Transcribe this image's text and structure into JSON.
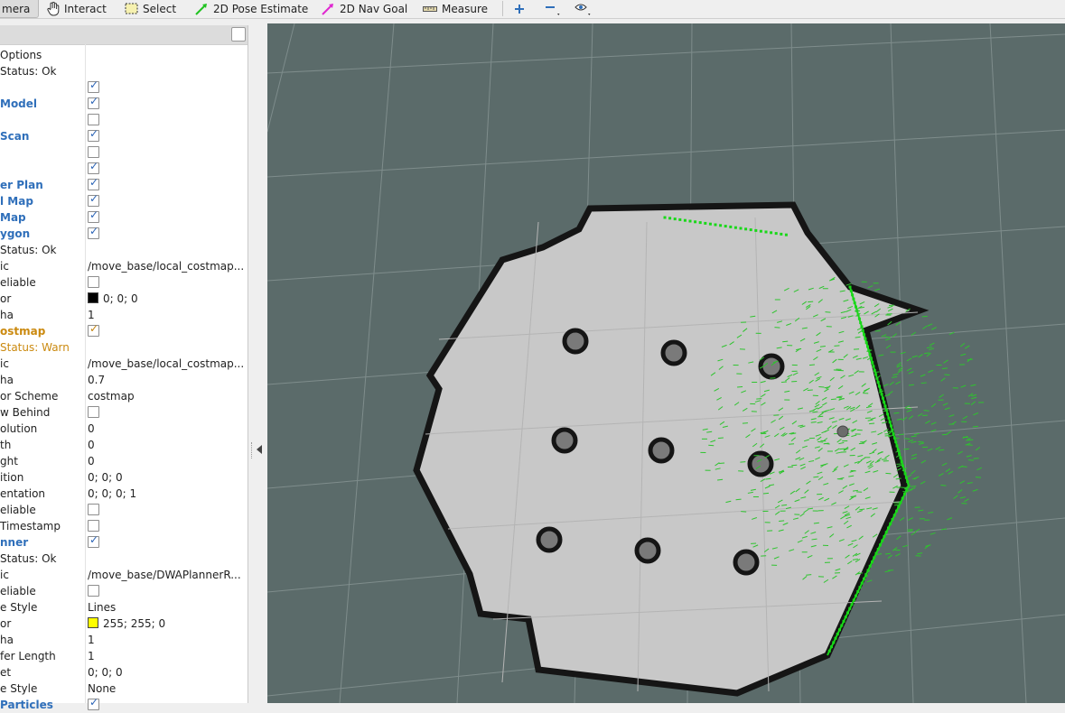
{
  "toolbar": {
    "items": [
      {
        "label": "mera",
        "icon": "camera-icon"
      },
      {
        "label": "Interact",
        "icon": "hand-icon"
      },
      {
        "label": "Select",
        "icon": "select-box-icon"
      },
      {
        "label": "2D Pose Estimate",
        "icon": "green-arrow-icon"
      },
      {
        "label": "2D Nav Goal",
        "icon": "magenta-arrow-icon"
      },
      {
        "label": "Measure",
        "icon": "ruler-icon"
      }
    ],
    "right_icons": [
      "plus-icon",
      "minus-icon",
      "eye-icon"
    ]
  },
  "displays": {
    "rows": [
      {
        "label": "Options",
        "kind": "text",
        "value": ""
      },
      {
        "label": "Status: Ok",
        "kind": "text",
        "value": ""
      },
      {
        "label": "",
        "kind": "check",
        "checked": true
      },
      {
        "label": "Model",
        "kind": "check",
        "checked": true,
        "style": "blue"
      },
      {
        "label": "",
        "kind": "check",
        "checked": false
      },
      {
        "label": "Scan",
        "kind": "check",
        "checked": true,
        "style": "blue"
      },
      {
        "label": "",
        "kind": "check",
        "checked": false
      },
      {
        "label": "",
        "kind": "check",
        "checked": true
      },
      {
        "label": "er Plan",
        "kind": "check",
        "checked": true,
        "style": "blue"
      },
      {
        "label": "l Map",
        "kind": "check",
        "checked": true,
        "style": "blue"
      },
      {
        "label": "Map",
        "kind": "check",
        "checked": true,
        "style": "blue"
      },
      {
        "label": "ygon",
        "kind": "check",
        "checked": true,
        "style": "blue"
      },
      {
        "label": "Status: Ok",
        "kind": "text",
        "value": ""
      },
      {
        "label": "ic",
        "kind": "text",
        "value": "/move_base/local_costmap..."
      },
      {
        "label": "eliable",
        "kind": "check",
        "checked": false
      },
      {
        "label": "or",
        "kind": "color",
        "value": "0; 0; 0",
        "color": "#000000"
      },
      {
        "label": "ha",
        "kind": "text",
        "value": "1"
      },
      {
        "label": "ostmap",
        "kind": "check",
        "checked": true,
        "style": "orange"
      },
      {
        "label": "Status: Warn",
        "kind": "text",
        "value": "",
        "style": "orangeText"
      },
      {
        "label": "ic",
        "kind": "text",
        "value": "/move_base/local_costmap..."
      },
      {
        "label": "ha",
        "kind": "text",
        "value": "0.7"
      },
      {
        "label": "or Scheme",
        "kind": "text",
        "value": "costmap"
      },
      {
        "label": "w Behind",
        "kind": "check",
        "checked": false
      },
      {
        "label": "olution",
        "kind": "text",
        "value": "0"
      },
      {
        "label": "th",
        "kind": "text",
        "value": "0"
      },
      {
        "label": "ght",
        "kind": "text",
        "value": "0"
      },
      {
        "label": "ition",
        "kind": "text",
        "value": "0; 0; 0"
      },
      {
        "label": "entation",
        "kind": "text",
        "value": "0; 0; 0; 1"
      },
      {
        "label": "eliable",
        "kind": "check",
        "checked": false
      },
      {
        "label": " Timestamp",
        "kind": "check",
        "checked": false
      },
      {
        "label": "nner",
        "kind": "check",
        "checked": true,
        "style": "blue"
      },
      {
        "label": "Status: Ok",
        "kind": "text",
        "value": ""
      },
      {
        "label": "ic",
        "kind": "text",
        "value": "/move_base/DWAPlannerR..."
      },
      {
        "label": "eliable",
        "kind": "check",
        "checked": false
      },
      {
        "label": "e Style",
        "kind": "text",
        "value": "Lines"
      },
      {
        "label": "or",
        "kind": "color",
        "value": "255; 255; 0",
        "color": "#ffff00"
      },
      {
        "label": "ha",
        "kind": "text",
        "value": "1"
      },
      {
        "label": "fer Length",
        "kind": "text",
        "value": "1"
      },
      {
        "label": "et",
        "kind": "text",
        "value": "0; 0; 0"
      },
      {
        "label": "e Style",
        "kind": "text",
        "value": "None"
      },
      {
        "label": "Particles",
        "kind": "check",
        "checked": true,
        "style": "blue"
      }
    ]
  },
  "colors": {
    "view_background": "#5b6b6a",
    "map_free": "#c8c8c8",
    "map_wall": "#151515",
    "laser": "#18d818",
    "particles": "#2ec42e",
    "accent_blue": "#2f6fba",
    "warn_orange": "#cb8a10"
  }
}
